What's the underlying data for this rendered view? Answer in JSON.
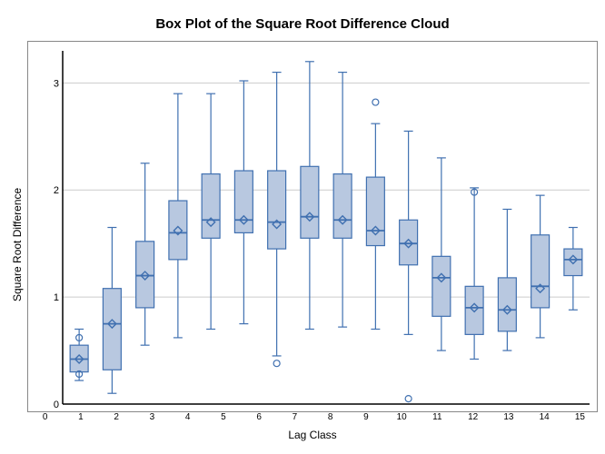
{
  "title": "Box Plot of the Square Root Difference Cloud",
  "yAxisLabel": "Square Root Difference",
  "xAxisLabel": "Lag Class",
  "yTicks": [
    0,
    1,
    2,
    3
  ],
  "xLabels": [
    "0",
    "1",
    "2",
    "3",
    "4",
    "5",
    "6",
    "7",
    "8",
    "9",
    "10",
    "11",
    "12",
    "13",
    "14",
    "15"
  ],
  "colors": {
    "box": "#b8c8e0",
    "boxStroke": "#4070b0",
    "whisker": "#4070b0",
    "median": "#4070b0",
    "mean": "#4070b0",
    "outlier": "#4070b0",
    "gridline": "#cccccc"
  },
  "boxes": [
    {
      "label": "0",
      "q1": 0.3,
      "q3": 0.55,
      "median": 0.42,
      "mean": 0.42,
      "whiskerLow": 0.22,
      "whiskerHigh": 0.7,
      "outliers": [
        0.62,
        0.28
      ]
    },
    {
      "label": "1",
      "q1": 0.32,
      "q3": 1.08,
      "median": 0.75,
      "mean": 0.75,
      "whiskerLow": 0.1,
      "whiskerHigh": 1.65,
      "outliers": []
    },
    {
      "label": "2",
      "q1": 0.9,
      "q3": 1.52,
      "median": 1.2,
      "mean": 1.2,
      "whiskerLow": 0.55,
      "whiskerHigh": 2.25,
      "outliers": []
    },
    {
      "label": "3",
      "q1": 1.35,
      "q3": 1.9,
      "median": 1.6,
      "mean": 1.62,
      "whiskerLow": 0.62,
      "whiskerHigh": 2.9,
      "outliers": []
    },
    {
      "label": "4",
      "q1": 1.55,
      "q3": 2.15,
      "median": 1.72,
      "mean": 1.7,
      "whiskerLow": 0.7,
      "whiskerHigh": 2.9,
      "outliers": []
    },
    {
      "label": "5",
      "q1": 1.6,
      "q3": 2.18,
      "median": 1.72,
      "mean": 1.72,
      "whiskerLow": 0.75,
      "whiskerHigh": 3.02,
      "outliers": []
    },
    {
      "label": "6",
      "q1": 1.45,
      "q3": 2.18,
      "median": 1.7,
      "mean": 1.68,
      "whiskerLow": 0.45,
      "whiskerHigh": 3.1,
      "outliers": [
        0.38
      ]
    },
    {
      "label": "7",
      "q1": 1.55,
      "q3": 2.22,
      "median": 1.75,
      "mean": 1.75,
      "whiskerLow": 0.7,
      "whiskerHigh": 3.2,
      "outliers": []
    },
    {
      "label": "8",
      "q1": 1.55,
      "q3": 2.15,
      "median": 1.72,
      "mean": 1.72,
      "whiskerLow": 0.72,
      "whiskerHigh": 3.1,
      "outliers": []
    },
    {
      "label": "9",
      "q1": 1.48,
      "q3": 2.12,
      "median": 1.62,
      "mean": 1.62,
      "whiskerLow": 0.7,
      "whiskerHigh": 2.62,
      "outliers": [
        2.82
      ]
    },
    {
      "label": "10",
      "q1": 1.3,
      "q3": 1.72,
      "median": 1.5,
      "mean": 1.5,
      "whiskerLow": 0.65,
      "whiskerHigh": 2.55,
      "outliers": [
        0.05
      ]
    },
    {
      "label": "11",
      "q1": 0.82,
      "q3": 1.38,
      "median": 1.18,
      "mean": 1.18,
      "whiskerLow": 0.5,
      "whiskerHigh": 2.3,
      "outliers": []
    },
    {
      "label": "12",
      "q1": 0.65,
      "q3": 1.1,
      "median": 0.9,
      "mean": 0.9,
      "whiskerLow": 0.42,
      "whiskerHigh": 2.02,
      "outliers": [
        1.98
      ]
    },
    {
      "label": "13",
      "q1": 0.68,
      "q3": 1.18,
      "median": 0.88,
      "mean": 0.88,
      "whiskerLow": 0.5,
      "whiskerHigh": 1.82,
      "outliers": []
    },
    {
      "label": "14",
      "q1": 0.9,
      "q3": 1.58,
      "median": 1.1,
      "mean": 1.08,
      "whiskerLow": 0.62,
      "whiskerHigh": 1.95,
      "outliers": []
    },
    {
      "label": "15",
      "q1": 1.2,
      "q3": 1.45,
      "median": 1.35,
      "mean": 1.35,
      "whiskerLow": 0.88,
      "whiskerHigh": 1.65,
      "outliers": []
    }
  ]
}
